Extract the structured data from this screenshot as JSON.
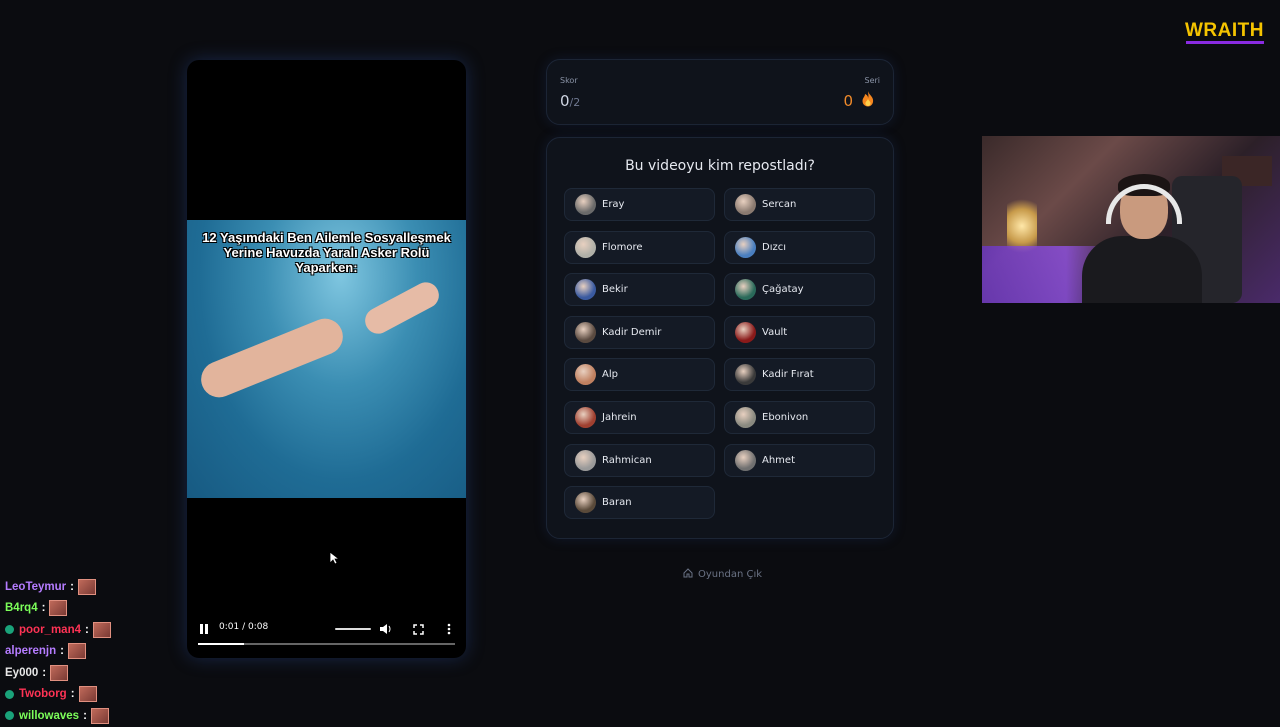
{
  "brand": {
    "name": "WRAITH",
    "color": "#f5c400",
    "underline_color": "#8a2be2"
  },
  "video": {
    "caption": "12 Yaşımdaki Ben Ailemle Sosyalleşmek Yerine Havuzda Yaralı Asker Rolü Yaparken:",
    "time": "0:01 / 0:08",
    "progress": 0.18,
    "icons": [
      "pause-icon",
      "volume-icon",
      "fullscreen-icon",
      "more-icon"
    ]
  },
  "score": {
    "label": "Skor",
    "value": "0",
    "total": "/2",
    "streak_label": "Seri",
    "streak_value": "0",
    "streak_icon": "flame-icon",
    "streak_color": "#f08a2a"
  },
  "question": {
    "title": "Bu videoyu kim repostladı?",
    "options": [
      {
        "label": "Eray",
        "avatar_color": "#6a6a6a"
      },
      {
        "label": "Sercan",
        "avatar_color": "#8a7a70"
      },
      {
        "label": "Flomore",
        "avatar_color": "#b0b0a8"
      },
      {
        "label": "Dızcı",
        "avatar_color": "#4a7fc0"
      },
      {
        "label": "Bekir",
        "avatar_color": "#3a5aa0"
      },
      {
        "label": "Çağatay",
        "avatar_color": "#2a6a5a"
      },
      {
        "label": "Kadir Demir",
        "avatar_color": "#5a4a40"
      },
      {
        "label": "Vault",
        "avatar_color": "#8a1a1a"
      },
      {
        "label": "Alp",
        "avatar_color": "#c08060"
      },
      {
        "label": "Kadir Fırat",
        "avatar_color": "#3a3a3a"
      },
      {
        "label": "Jahrein",
        "avatar_color": "#a04030"
      },
      {
        "label": "Ebonivon",
        "avatar_color": "#8a8a80"
      },
      {
        "label": "Rahmican",
        "avatar_color": "#9a9a9a"
      },
      {
        "label": "Ahmet",
        "avatar_color": "#707070"
      },
      {
        "label": "Baran",
        "avatar_color": "#5a4a3a"
      }
    ]
  },
  "exit": {
    "label": "Oyundan Çık",
    "icon": "home-icon"
  },
  "chat": [
    {
      "user": "LeoTeymur",
      "color": "#b57cff",
      "badge": false
    },
    {
      "user": "B4rq4",
      "color": "#7cff5a",
      "badge": false
    },
    {
      "user": "poor_man4",
      "color": "#ff3355",
      "badge": true
    },
    {
      "user": "alperenjn",
      "color": "#b57cff",
      "badge": false
    },
    {
      "user": "Ey000",
      "color": "#e8e8e8",
      "badge": false
    },
    {
      "user": "Twoborg",
      "color": "#ff3355",
      "badge": true
    },
    {
      "user": "willowaves",
      "color": "#7cff5a",
      "badge": true
    }
  ]
}
